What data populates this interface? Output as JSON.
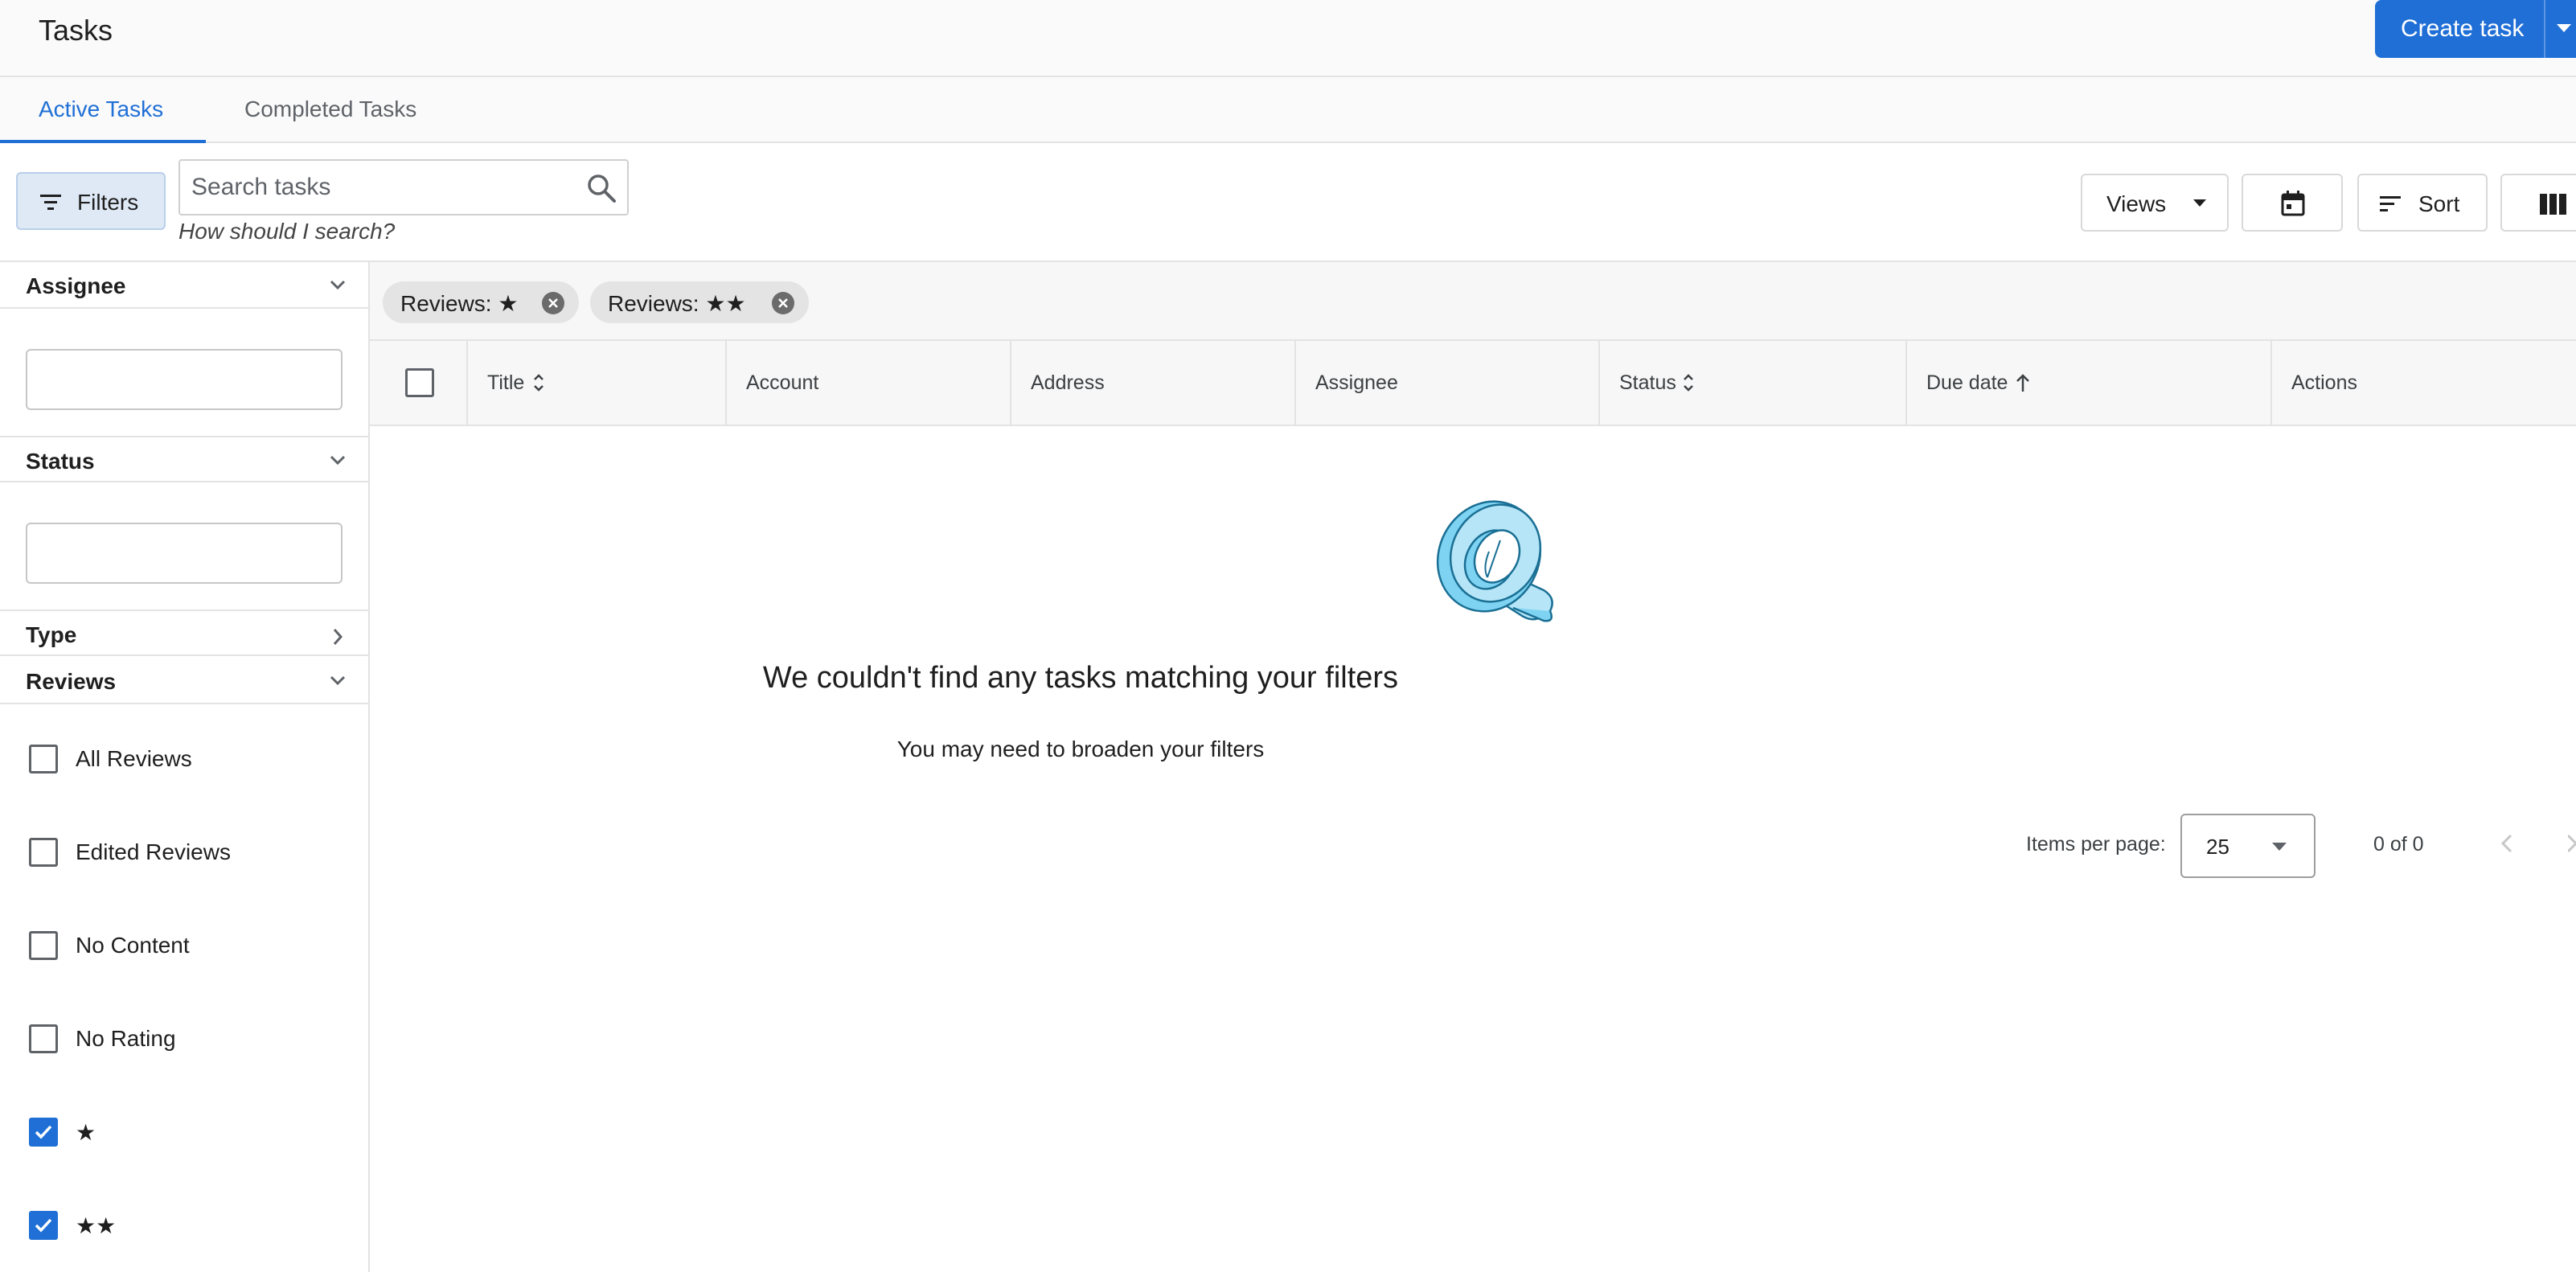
{
  "header": {
    "title": "Tasks",
    "create_label": "Create task"
  },
  "tabs": [
    {
      "label": "Active Tasks",
      "active": true
    },
    {
      "label": "Completed Tasks",
      "active": false
    }
  ],
  "toolbar": {
    "filters_label": "Filters",
    "search_placeholder": "Search tasks",
    "search_value": "",
    "search_hint": "How should I search?",
    "views_label": "Views",
    "sort_label": "Sort",
    "icons": [
      "filter-icon",
      "search-icon",
      "calendar-icon",
      "sort-icon",
      "columns-icon"
    ]
  },
  "sidebar": {
    "assignee": {
      "label": "Assignee",
      "value": ""
    },
    "status": {
      "label": "Status",
      "value": ""
    },
    "type": {
      "label": "Type"
    },
    "reviews": {
      "label": "Reviews",
      "options": [
        {
          "label": "All Reviews",
          "checked": false
        },
        {
          "label": "Edited Reviews",
          "checked": false
        },
        {
          "label": "No Content",
          "checked": false
        },
        {
          "label": "No Rating",
          "checked": false
        },
        {
          "label": "★",
          "checked": true
        },
        {
          "label": "★★",
          "checked": true
        }
      ]
    }
  },
  "chips": [
    {
      "label": "Reviews: ★"
    },
    {
      "label": "Reviews: ★★"
    }
  ],
  "table": {
    "columns": [
      "Title",
      "Account",
      "Address",
      "Assignee",
      "Status",
      "Due date",
      "Actions"
    ]
  },
  "empty_state": {
    "title": "We couldn't find any tasks matching your filters",
    "subtitle": "You may need to broaden your filters"
  },
  "pagination": {
    "items_per_page_label": "Items per page:",
    "items_per_page": "25",
    "range": "0 of 0"
  },
  "colors": {
    "accent": "#1f6fd6",
    "illustration": "#7fd3f2"
  }
}
